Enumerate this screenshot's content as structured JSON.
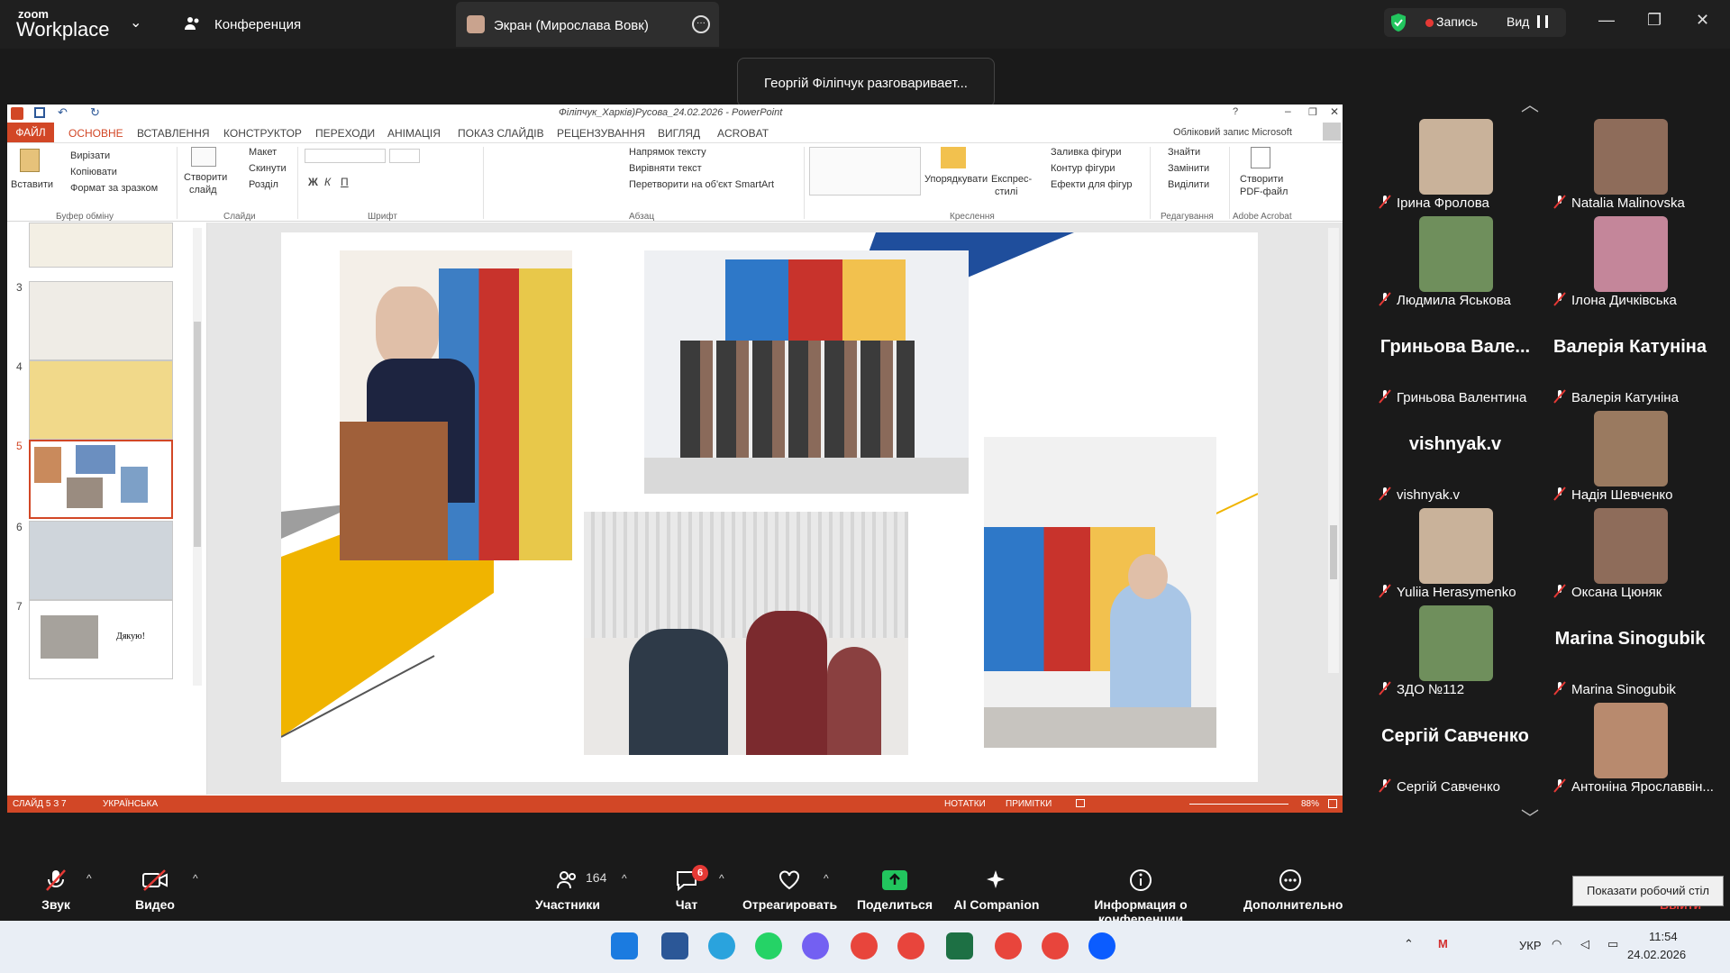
{
  "zoom": {
    "logo_top": "zoom",
    "logo_bottom": "Workplace",
    "conference_label": "Конференция",
    "screen_tab_label": "Экран (Мирослава Вовк)",
    "record_label": "Запись",
    "view_label": "Вид",
    "notification": "Георгій Філіпчук разговаривает..."
  },
  "ppt": {
    "window_title": "Філіпчук_Харків)Русова_24.02.2026 - PowerPoint",
    "account": "Обліковий запис Microsoft",
    "tabs": [
      "ФАЙЛ",
      "ОСНОВНЕ",
      "ВСТАВЛЕННЯ",
      "КОНСТРУКТОР",
      "ПЕРЕХОДИ",
      "АНІМАЦІЯ",
      "ПОКАЗ СЛАЙДІВ",
      "РЕЦЕНЗУВАННЯ",
      "ВИГЛЯД",
      "ACROBAT"
    ],
    "ribbon": {
      "paste": "Вставити",
      "cut": "Вирізати",
      "copy": "Копіювати",
      "format_painter": "Формат за зразком",
      "clipboard_group": "Буфер обміну",
      "new_slide_1": "Створити",
      "new_slide_2": "слайд",
      "layout": "Макет",
      "reset": "Скинути",
      "section": "Розділ",
      "slides_group": "Слайди",
      "font_group": "Шрифт",
      "text_direction": "Напрямок тексту",
      "align_text": "Вирівняти текст",
      "smartart": "Перетворити на об'єкт SmartArt",
      "paragraph_group": "Абзац",
      "arrange": "Упорядкувати",
      "quick_styles_1": "Експрес-",
      "quick_styles_2": "стилі",
      "shape_fill": "Заливка фігури",
      "shape_outline": "Контур фігури",
      "shape_effects": "Ефекти для фігур",
      "drawing_group": "Креслення",
      "find": "Знайти",
      "replace": "Замінити",
      "select": "Виділити",
      "editing_group": "Редагування",
      "create_pdf_1": "Створити",
      "create_pdf_2": "PDF-файл",
      "acrobat_group": "Adobe Acrobat"
    },
    "thumbnails": [
      "3",
      "4",
      "5",
      "6",
      "7"
    ],
    "thumb7_text": "Дякую!",
    "status": {
      "slide": "СЛАЙД 5 З 7",
      "language": "УКРАЇНСЬКА",
      "notes": "НОТАТКИ",
      "comments": "ПРИМІТКИ",
      "zoom": "88%"
    }
  },
  "participants": [
    {
      "name": "Ірина Фролова",
      "photo": true
    },
    {
      "name": "Natalia Malinovska",
      "photo": true
    },
    {
      "name": "Людмила Яськова",
      "photo": true
    },
    {
      "name": "Ілона Дичківська",
      "photo": true
    },
    {
      "name": "Гриньова Валентина",
      "big": "Гриньова Вале..."
    },
    {
      "name": "Валерія Катуніна",
      "big": "Валерія Катуніна"
    },
    {
      "name": "vishnyak.v",
      "big": "vishnyak.v"
    },
    {
      "name": "Надія Шевченко",
      "photo": true
    },
    {
      "name": "Yuliia Herasymenko",
      "photo": true
    },
    {
      "name": "Оксана Цюняк",
      "photo": true
    },
    {
      "name": "ЗДО №112",
      "photo": true
    },
    {
      "name": "Marina Sinogubik",
      "big": "Marina Sinogubik"
    },
    {
      "name": "Сергій Савченко",
      "big": "Сергій Савченко"
    },
    {
      "name": "Антоніна Ярославвін...",
      "photo": true
    }
  ],
  "toolbar": {
    "audio": "Звук",
    "video": "Видео",
    "participants_count": "164",
    "participants": "Участники",
    "chat_badge": "6",
    "chat": "Чат",
    "react": "Отреагировать",
    "share": "Поделиться",
    "ai": "AI Companion",
    "info": "Информация о конференции",
    "more": "Дополнительно",
    "leave": "Выйти"
  },
  "tooltip": "Показати робочий стіл",
  "taskbar": {
    "lang": "УКР",
    "time": "11:54",
    "date": "24.02.2026"
  },
  "colors": {
    "ppt_accent": "#d24726",
    "zoom_bg": "#1a1a1a",
    "share_green": "#22c55e",
    "slide_yellow": "#f0b400",
    "slide_blue": "#1f4e9c"
  }
}
